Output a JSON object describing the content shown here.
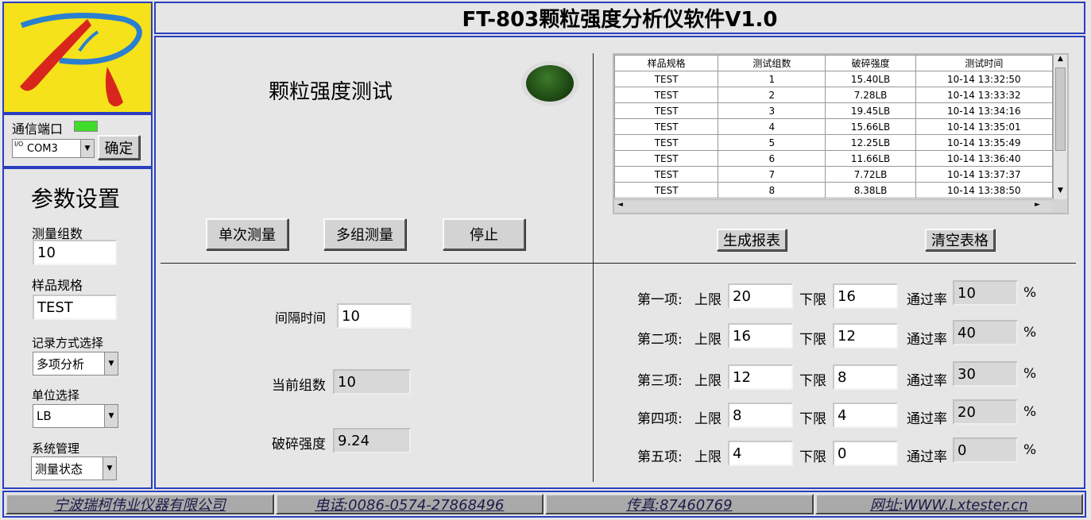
{
  "title": "FT-803颗粒强度分析仪软件V1.0",
  "com": {
    "label": "通信端口",
    "port": "COM3",
    "io_glyph": "I/O",
    "confirm": "确定"
  },
  "params": {
    "heading": "参数设置",
    "groups_label": "测量组数",
    "groups_value": "10",
    "spec_label": "样品规格",
    "spec_value": "TEST",
    "record_label": "记录方式选择",
    "record_value": "多项分析",
    "unit_label": "单位选择",
    "unit_value": "LB",
    "sys_label": "系统管理",
    "sys_value": "测量状态"
  },
  "test": {
    "heading": "颗粒强度测试",
    "btn_single": "单次测量",
    "btn_multi": "多组测量",
    "btn_stop": "停止",
    "interval_label": "间隔时间",
    "interval_value": "10",
    "current_label": "当前组数",
    "current_value": "10",
    "strength_label": "破碎强度",
    "strength_value": "9.24"
  },
  "table": {
    "headers": [
      "样品规格",
      "测试组数",
      "破碎强度",
      "测试时间"
    ],
    "rows": [
      [
        "TEST",
        "1",
        "15.40LB",
        "10-14 13:32:50"
      ],
      [
        "TEST",
        "2",
        "7.28LB",
        "10-14 13:33:32"
      ],
      [
        "TEST",
        "3",
        "19.45LB",
        "10-14 13:34:16"
      ],
      [
        "TEST",
        "4",
        "15.66LB",
        "10-14 13:35:01"
      ],
      [
        "TEST",
        "5",
        "12.25LB",
        "10-14 13:35:49"
      ],
      [
        "TEST",
        "6",
        "11.66LB",
        "10-14 13:36:40"
      ],
      [
        "TEST",
        "7",
        "7.72LB",
        "10-14 13:37:37"
      ],
      [
        "TEST",
        "8",
        "8.38LB",
        "10-14 13:38:50"
      ]
    ],
    "btn_report": "生成报表",
    "btn_clear": "清空表格"
  },
  "limits": {
    "upper": "上限",
    "lower": "下限",
    "pass": "通过率",
    "pct": "%",
    "items": [
      {
        "name": "第一项:",
        "upper": "20",
        "lower": "16",
        "rate": "10"
      },
      {
        "name": "第二项:",
        "upper": "16",
        "lower": "12",
        "rate": "40"
      },
      {
        "name": "第三项:",
        "upper": "12",
        "lower": "8",
        "rate": "30"
      },
      {
        "name": "第四项:",
        "upper": "8",
        "lower": "4",
        "rate": "20"
      },
      {
        "name": "第五项:",
        "upper": "4",
        "lower": "0",
        "rate": "0"
      }
    ]
  },
  "footer": {
    "company": "宁波瑞柯伟业仪器有限公司",
    "phone": "电话:0086-0574-27868496",
    "fax": "传真:87460769",
    "web": "网址:WWW.Lxtester.cn"
  },
  "colors": {
    "border": "#2a3fbf",
    "logo_bg": "#f5e21b",
    "indicator": "#1f4a14",
    "com_led": "#3fdc2a"
  }
}
